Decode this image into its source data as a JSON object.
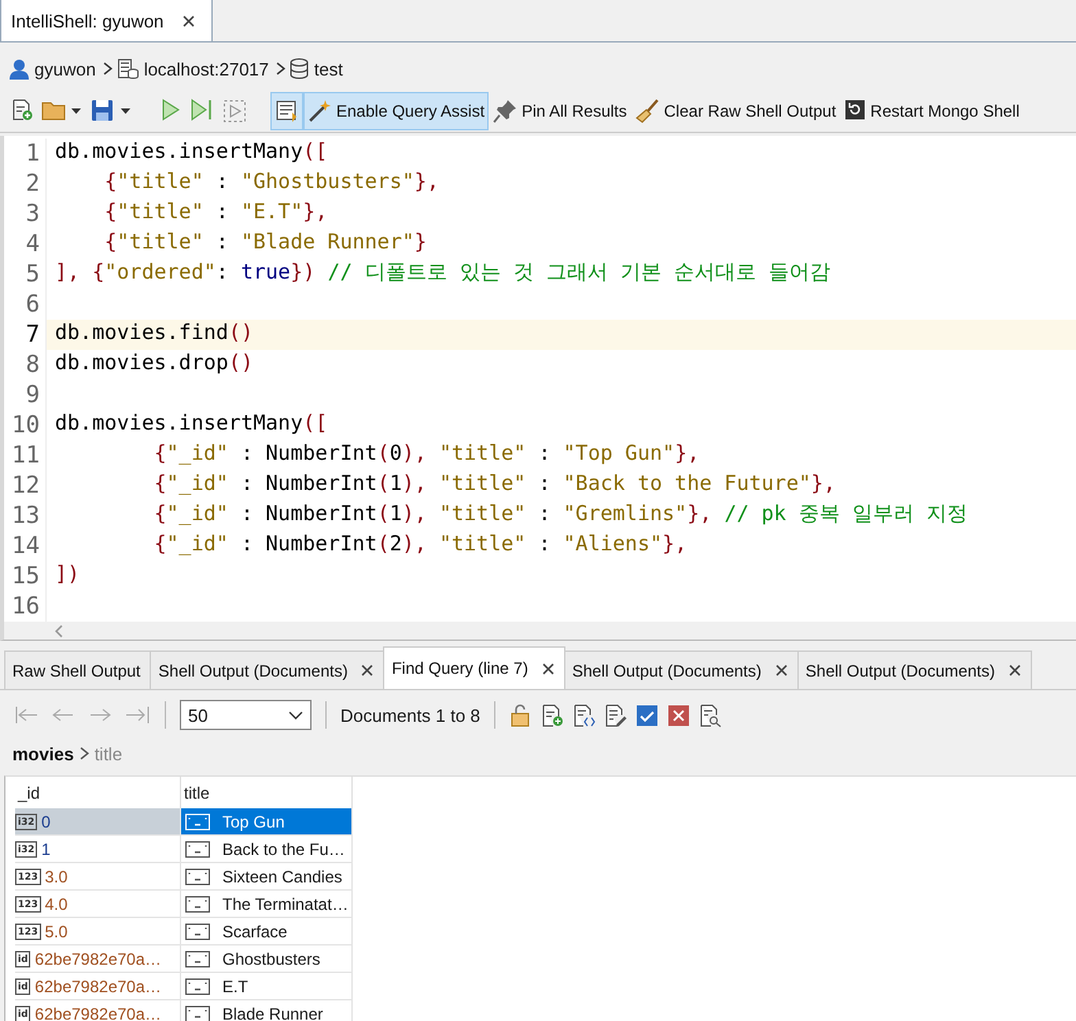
{
  "shell_tab": {
    "label": "IntelliShell: gyuwon",
    "selected": true
  },
  "breadcrumb": [
    {
      "kind": "user",
      "label": "gyuwon"
    },
    {
      "kind": "server",
      "label": "localhost:27017"
    },
    {
      "kind": "database",
      "label": "test"
    }
  ],
  "toolbar": [
    {
      "kind": "new",
      "on": false
    },
    {
      "kind": "open",
      "on": false
    },
    {
      "kind": "save",
      "on": false
    },
    {
      "kind": "run",
      "on": false
    },
    {
      "kind": "step",
      "on": false
    },
    {
      "kind": "run-selection",
      "on": false
    },
    {
      "kind": "format",
      "on": true
    },
    {
      "kind": "assist",
      "label": "Enable Query Assist",
      "on": true
    },
    {
      "kind": "pin",
      "label": "Pin All Results",
      "on": false
    },
    {
      "kind": "clear",
      "label": "Clear Raw Shell Output",
      "on": false
    },
    {
      "kind": "restart",
      "label": "Restart Mongo Shell",
      "on": false
    }
  ],
  "editor": {
    "lines": [
      {
        "number": "1",
        "current": false,
        "tokens": [
          {
            "kind": "plain",
            "text": "db.movies.insertMany"
          },
          {
            "kind": "punct",
            "text": "(["
          }
        ]
      },
      {
        "number": "2",
        "current": false,
        "tokens": [
          {
            "kind": "punct",
            "text": "    {"
          },
          {
            "kind": "string",
            "text": "\"title\""
          },
          {
            "kind": "plain",
            "text": " : "
          },
          {
            "kind": "string",
            "text": "\"Ghostbusters\""
          },
          {
            "kind": "punct",
            "text": "},"
          }
        ]
      },
      {
        "number": "3",
        "current": false,
        "tokens": [
          {
            "kind": "punct",
            "text": "    {"
          },
          {
            "kind": "string",
            "text": "\"title\""
          },
          {
            "kind": "plain",
            "text": " : "
          },
          {
            "kind": "string",
            "text": "\"E.T\""
          },
          {
            "kind": "punct",
            "text": "},"
          }
        ]
      },
      {
        "number": "4",
        "current": false,
        "tokens": [
          {
            "kind": "punct",
            "text": "    {"
          },
          {
            "kind": "string",
            "text": "\"title\""
          },
          {
            "kind": "plain",
            "text": " : "
          },
          {
            "kind": "string",
            "text": "\"Blade Runner\""
          },
          {
            "kind": "punct",
            "text": "}"
          }
        ]
      },
      {
        "number": "5",
        "current": false,
        "tokens": [
          {
            "kind": "punct",
            "text": "], {"
          },
          {
            "kind": "string",
            "text": "\"ordered\""
          },
          {
            "kind": "plain",
            "text": ": "
          },
          {
            "kind": "keyword",
            "text": "true"
          },
          {
            "kind": "punct",
            "text": "}) "
          },
          {
            "kind": "comment",
            "text": "// 디폴트로 있는 것 그래서 기본 순서대로 들어감"
          }
        ]
      },
      {
        "number": "6",
        "current": false
      },
      {
        "number": "7",
        "current": true,
        "tokens": [
          {
            "kind": "plain",
            "text": "db.movies.find"
          },
          {
            "kind": "punct",
            "text": "()"
          }
        ]
      },
      {
        "number": "8",
        "current": false,
        "tokens": [
          {
            "kind": "plain",
            "text": "db.movies.drop"
          },
          {
            "kind": "punct",
            "text": "()"
          }
        ]
      },
      {
        "number": "9",
        "current": false
      },
      {
        "number": "10",
        "current": false,
        "tokens": [
          {
            "kind": "plain",
            "text": "db.movies.insertMany"
          },
          {
            "kind": "punct",
            "text": "(["
          }
        ]
      },
      {
        "number": "11",
        "current": false,
        "tokens": [
          {
            "kind": "punct",
            "text": "        {"
          },
          {
            "kind": "string",
            "text": "\"_id\""
          },
          {
            "kind": "plain",
            "text": " : NumberInt"
          },
          {
            "kind": "punct",
            "text": "("
          },
          {
            "kind": "plain",
            "text": "0"
          },
          {
            "kind": "punct",
            "text": "), "
          },
          {
            "kind": "string",
            "text": "\"title\""
          },
          {
            "kind": "plain",
            "text": " : "
          },
          {
            "kind": "string",
            "text": "\"Top Gun\""
          },
          {
            "kind": "punct",
            "text": "},"
          }
        ]
      },
      {
        "number": "12",
        "current": false,
        "tokens": [
          {
            "kind": "punct",
            "text": "        {"
          },
          {
            "kind": "string",
            "text": "\"_id\""
          },
          {
            "kind": "plain",
            "text": " : NumberInt"
          },
          {
            "kind": "punct",
            "text": "("
          },
          {
            "kind": "plain",
            "text": "1"
          },
          {
            "kind": "punct",
            "text": "), "
          },
          {
            "kind": "string",
            "text": "\"title\""
          },
          {
            "kind": "plain",
            "text": " : "
          },
          {
            "kind": "string",
            "text": "\"Back to the Future\""
          },
          {
            "kind": "punct",
            "text": "},"
          }
        ]
      },
      {
        "number": "13",
        "current": false,
        "tokens": [
          {
            "kind": "punct",
            "text": "        {"
          },
          {
            "kind": "string",
            "text": "\"_id\""
          },
          {
            "kind": "plain",
            "text": " : NumberInt"
          },
          {
            "kind": "punct",
            "text": "("
          },
          {
            "kind": "plain",
            "text": "1"
          },
          {
            "kind": "punct",
            "text": "), "
          },
          {
            "kind": "string",
            "text": "\"title\""
          },
          {
            "kind": "plain",
            "text": " : "
          },
          {
            "kind": "string",
            "text": "\"Gremlins\""
          },
          {
            "kind": "punct",
            "text": "}, "
          },
          {
            "kind": "comment",
            "text": "// pk 중복 일부러 지정"
          }
        ]
      },
      {
        "number": "14",
        "current": false,
        "tokens": [
          {
            "kind": "punct",
            "text": "        {"
          },
          {
            "kind": "string",
            "text": "\"_id\""
          },
          {
            "kind": "plain",
            "text": " : NumberInt"
          },
          {
            "kind": "punct",
            "text": "("
          },
          {
            "kind": "plain",
            "text": "2"
          },
          {
            "kind": "punct",
            "text": "), "
          },
          {
            "kind": "string",
            "text": "\"title\""
          },
          {
            "kind": "plain",
            "text": " : "
          },
          {
            "kind": "string",
            "text": "\"Aliens\""
          },
          {
            "kind": "punct",
            "text": "},"
          }
        ]
      },
      {
        "number": "15",
        "current": false,
        "tokens": [
          {
            "kind": "punct",
            "text": "])"
          }
        ]
      },
      {
        "number": "16",
        "current": false
      }
    ]
  },
  "result_tabs": [
    {
      "label": "Raw Shell Output",
      "closable": false,
      "selected": false
    },
    {
      "label": "Shell Output (Documents)",
      "closable": true,
      "selected": false
    },
    {
      "label": "Find Query (line 7)",
      "closable": true,
      "selected": true
    },
    {
      "label": "Shell Output (Documents)",
      "closable": true,
      "selected": false
    },
    {
      "label": "Shell Output (Documents)",
      "closable": true,
      "selected": false
    }
  ],
  "pager": {
    "page_size": "50",
    "range": "Documents 1 to 8"
  },
  "path": [
    {
      "label": "movies"
    },
    {
      "label": "title"
    }
  ],
  "grid": {
    "columns": [
      "_id",
      "title"
    ],
    "rows": [
      {
        "id_type": "i32",
        "id": "0",
        "title": "Top Gun",
        "selected": true
      },
      {
        "id_type": "i32",
        "id": "1",
        "title": "Back to the Fu…",
        "selected": false
      },
      {
        "id_type": "123",
        "id": "3.0",
        "title": "Sixteen Candies",
        "selected": false
      },
      {
        "id_type": "123",
        "id": "4.0",
        "title": "The Terminatat…",
        "selected": false
      },
      {
        "id_type": "123",
        "id": "5.0",
        "title": "Scarface",
        "selected": false
      },
      {
        "id_type": "id",
        "id": "62be7982e70a…",
        "title": "Ghostbusters",
        "selected": false
      },
      {
        "id_type": "id",
        "id": "62be7982e70a…",
        "title": "E.T",
        "selected": false
      },
      {
        "id_type": "id",
        "id": "62be7982e70a…",
        "title": "Blade Runner",
        "selected": false
      }
    ]
  }
}
